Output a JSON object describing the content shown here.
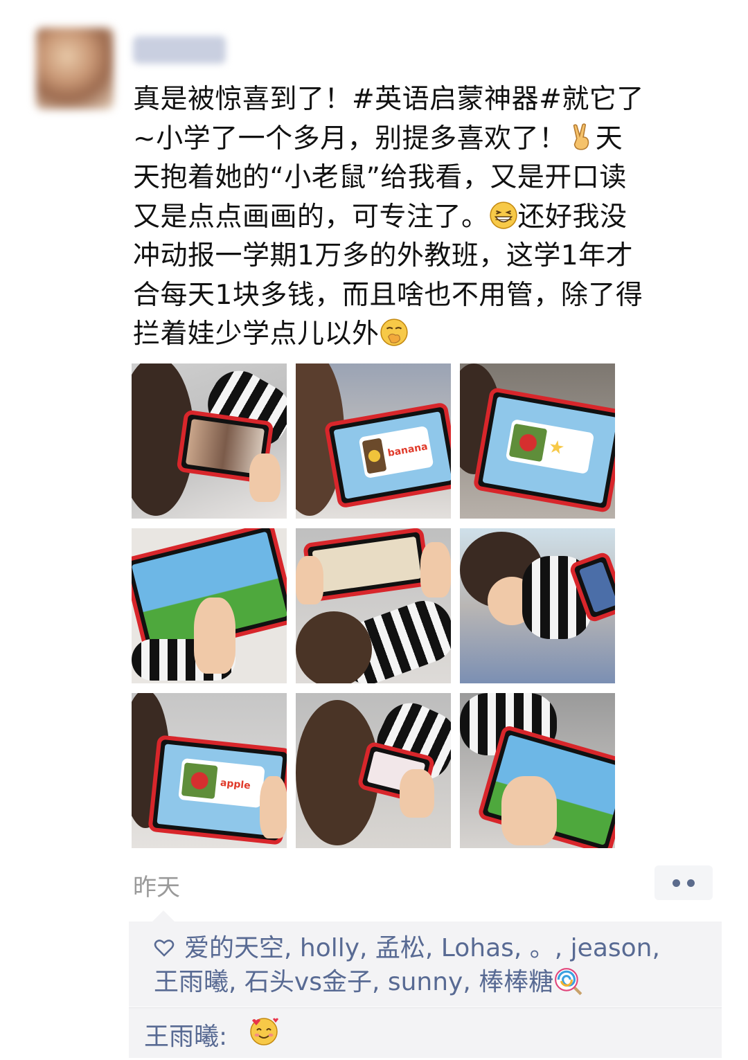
{
  "post": {
    "text_line1": "真是被惊喜到了！#英语启蒙神器#就它了",
    "text_line2": "~小学了一个多月，别提多喜欢了！",
    "text_line2b": "天",
    "text_line3": "天抱着她的“小老鼠”给我看，又是开口读",
    "text_line4": "又是点点画画的，可专注了。",
    "text_line4b": "还好我没",
    "text_line5": "冲动报一学期1万多的外教班，这学1年才",
    "text_line6": "合每天1块多钱，而且啥也不用管，除了得",
    "text_line7": "拦着娃少学点儿以外",
    "emoji_1": "victory-hand-emoji",
    "emoji_2": "grinning-squint-emoji",
    "emoji_3": "hand-over-mouth-emoji",
    "photos": [
      {
        "word": ""
      },
      {
        "word": "banana"
      },
      {
        "word": ""
      },
      {
        "word": ""
      },
      {
        "word": ""
      },
      {
        "word": ""
      },
      {
        "word": "apple"
      },
      {
        "word": ""
      },
      {
        "word": ""
      }
    ],
    "timestamp": "昨天"
  },
  "likes": {
    "icon": "heart-outline-icon",
    "line1": "爱的天空, holly, 孟松, Lohas, 。, jeason,",
    "line2": "王雨曦, 石头vs金子, sunny, 棒棒糖"
  },
  "comment": {
    "author": "王雨曦:",
    "emoji": "smiling-face-with-hearts-emoji"
  },
  "colors": {
    "link": "#586a93",
    "timestamp": "#9a9a9a",
    "panel": "#f3f3f5",
    "tablet_frame": "#d8262b"
  }
}
